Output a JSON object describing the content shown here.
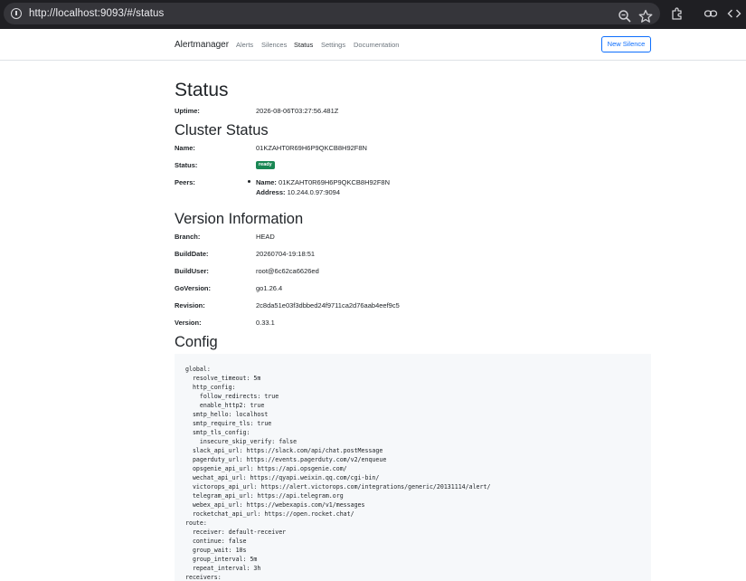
{
  "browser": {
    "url": "http://localhost:9093/#/status"
  },
  "navbar": {
    "brand": "Alertmanager",
    "links": [
      "Alerts",
      "Silences",
      "Status",
      "Settings",
      "Documentation"
    ],
    "active": "Status",
    "new_silence": "New Silence"
  },
  "status": {
    "title": "Status",
    "uptime_label": "Uptime:",
    "uptime_value": "2026-08-06T03:27:56.481Z"
  },
  "cluster": {
    "title": "Cluster Status",
    "name_label": "Name:",
    "name_value": "01KZAHT0R69H6P9QKCB8H92F8N",
    "status_label": "Status:",
    "status_badge": "ready",
    "status_color": "#198754",
    "peers_label": "Peers:",
    "peer_name_label": "Name:",
    "peer_name_value": "01KZAHT0R69H6P9QKCB8H92F8N",
    "peer_address_label": "Address:",
    "peer_address_value": "10.244.0.97:9094"
  },
  "version": {
    "title": "Version Information",
    "rows": [
      {
        "label": "Branch:",
        "value": "HEAD"
      },
      {
        "label": "BuildDate:",
        "value": "20260704-19:18:51"
      },
      {
        "label": "BuildUser:",
        "value": "root@6c62ca6626ed"
      },
      {
        "label": "GoVersion:",
        "value": "go1.26.4"
      },
      {
        "label": "Revision:",
        "value": "2c8da51e03f3dbbed24f9711ca2d76aab4eef9c5"
      },
      {
        "label": "Version:",
        "value": "0.33.1"
      }
    ]
  },
  "config": {
    "title": "Config",
    "yaml": "global:\n  resolve_timeout: 5m\n  http_config:\n    follow_redirects: true\n    enable_http2: true\n  smtp_hello: localhost\n  smtp_require_tls: true\n  smtp_tls_config:\n    insecure_skip_verify: false\n  slack_api_url: https://slack.com/api/chat.postMessage\n  pagerduty_url: https://events.pagerduty.com/v2/enqueue\n  opsgenie_api_url: https://api.opsgenie.com/\n  wechat_api_url: https://qyapi.weixin.qq.com/cgi-bin/\n  victorops_api_url: https://alert.victorops.com/integrations/generic/20131114/alert/\n  telegram_api_url: https://api.telegram.org\n  webex_api_url: https://webexapis.com/v1/messages\n  rocketchat_api_url: https://open.rocket.chat/\nroute:\n  receiver: default-receiver\n  continue: false\n  group_wait: 10s\n  group_interval: 5m\n  repeat_interval: 3h\nreceivers:"
  }
}
